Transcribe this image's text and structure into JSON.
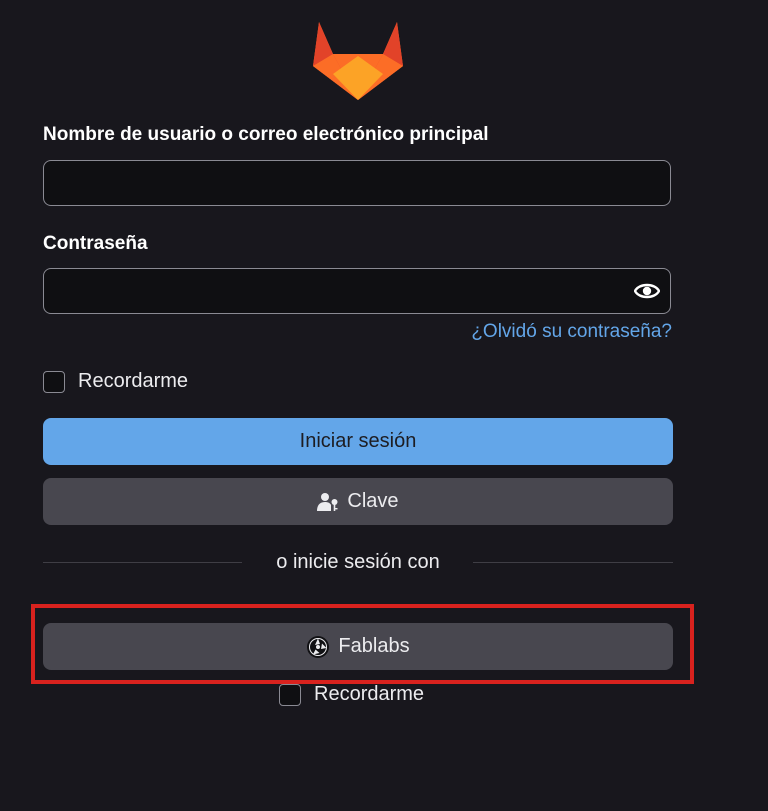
{
  "logo": {
    "name": "gitlab-logo",
    "colors": [
      "#e24329",
      "#fc6d26",
      "#fca326"
    ]
  },
  "form": {
    "username_label": "Nombre de usuario o correo electrónico principal",
    "username_value": "",
    "password_label": "Contraseña",
    "password_value": "",
    "show_password_icon": "eye-icon",
    "forgot_password": "¿Olvidó su contraseña?",
    "remember_me": "Recordarme",
    "sign_in_button": "Iniciar sesión",
    "passkey_button": "Clave",
    "passkey_icon": "user-key-icon"
  },
  "divider_text": "o inicie sesión con",
  "providers": [
    {
      "label": "Fablabs",
      "icon": "fablabs-icon"
    }
  ],
  "provider_remember_me": "Recordarme",
  "colors": {
    "background": "#18171d",
    "primary": "#63a6e9",
    "secondary": "#48474f",
    "link": "#63a6e9",
    "highlight": "#d8221e"
  }
}
